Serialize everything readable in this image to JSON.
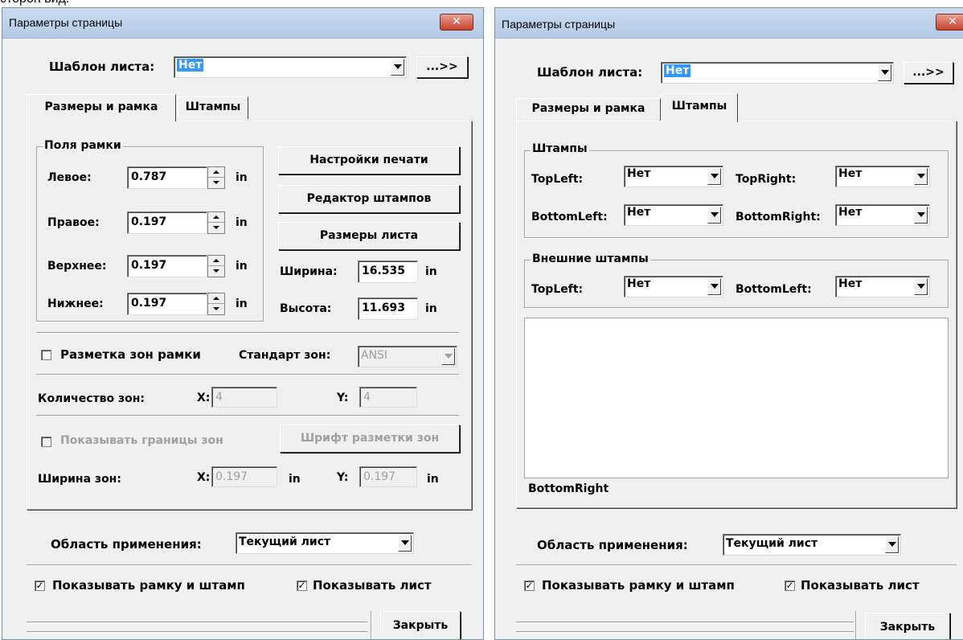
{
  "cut_text": "сторон вид:",
  "left": {
    "title": "Параметры страницы",
    "close_glyph": "✕",
    "template_label": "Шаблон листа:",
    "template_value": "Нет",
    "more_button": "...>>",
    "tabs": [
      "Размеры и рамка",
      "Штампы"
    ],
    "active_tab": 0,
    "frame_group": "Поля рамки",
    "margins": [
      {
        "label": "Левое:",
        "value": "0.787",
        "unit": "in"
      },
      {
        "label": "Правое:",
        "value": "0.197",
        "unit": "in"
      },
      {
        "label": "Верхнее:",
        "value": "0.197",
        "unit": "in"
      },
      {
        "label": "Нижнее:",
        "value": "0.197",
        "unit": "in"
      }
    ],
    "print_settings_button": "Настройки печати",
    "stamp_editor_button": "Редактор штампов",
    "sheet_size_button": "Размеры листа",
    "width_label": "Ширина:",
    "width_value": "16.535",
    "height_label": "Высота:",
    "height_value": "11.693",
    "size_unit": "in",
    "zone_marking_label": "Разметка зон рамки",
    "zone_marking_checked": false,
    "zone_standard_label": "Стандарт зон:",
    "zone_standard_value": "ANSI",
    "zone_count_label": "Количество зон:",
    "zone_x_label": "X:",
    "zone_x_value": "4",
    "zone_y_label": "Y:",
    "zone_y_value": "4",
    "show_zone_borders_label": "Показывать границы зон",
    "show_zone_borders_checked": false,
    "zone_font_button": "Шрифт разметки зон",
    "zone_width_label": "Ширина зон:",
    "zone_wx_label": "X:",
    "zone_wx_value": "0.197",
    "zone_wy_label": "Y:",
    "zone_wy_value": "0.197",
    "zone_w_unit": "in",
    "scope_label": "Область применения:",
    "scope_value": "Текущий лист",
    "show_frame_label": "Показывать рамку и штамп",
    "show_frame_checked": true,
    "show_sheet_label": "Показывать лист",
    "show_sheet_checked": true,
    "close_button": "Закрыть",
    "check_mark": "✓"
  },
  "right": {
    "title": "Параметры страницы",
    "close_glyph": "✕",
    "template_label": "Шаблон листа:",
    "template_value": "Нет",
    "more_button": "...>>",
    "tabs": [
      "Размеры и рамка",
      "Штампы"
    ],
    "active_tab": 1,
    "stamps_group": "Штампы",
    "stamps": [
      {
        "label": "TopLeft:",
        "value": "Нет"
      },
      {
        "label": "TopRight:",
        "value": "Нет"
      },
      {
        "label": "BottomLeft:",
        "value": "Нет"
      },
      {
        "label": "BottomRight:",
        "value": "Нет"
      }
    ],
    "external_group": "Внешние штампы",
    "external_stamps": [
      {
        "label": "TopLeft:",
        "value": "Нет"
      },
      {
        "label": "BottomLeft:",
        "value": "Нет"
      }
    ],
    "preview_caption": "BottomRight",
    "scope_label": "Область применения:",
    "scope_value": "Текущий лист",
    "show_frame_label": "Показывать рамку и штамп",
    "show_frame_checked": true,
    "show_sheet_label": "Показывать лист",
    "show_sheet_checked": true,
    "close_button": "Закрыть",
    "check_mark": "✓"
  }
}
